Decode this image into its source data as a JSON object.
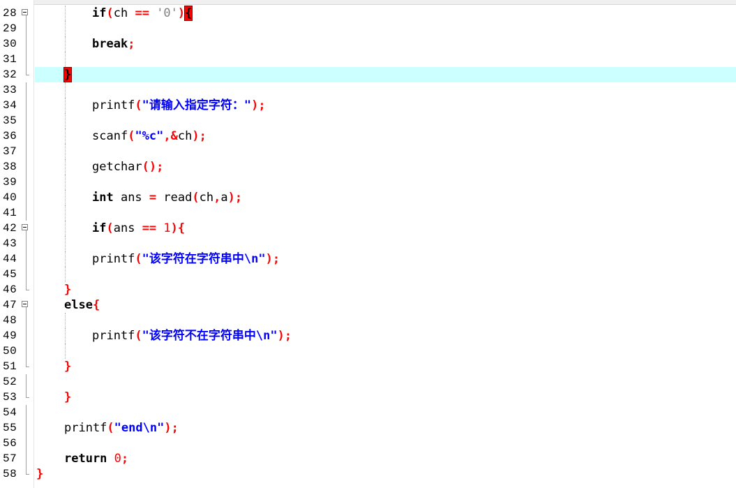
{
  "editor": {
    "current_line": 32,
    "lines": [
      {
        "n": "28",
        "fold": "start",
        "indent": 2,
        "code": [
          {
            "t": "kw",
            "v": "if"
          },
          {
            "t": "op",
            "v": "("
          },
          {
            "t": "id",
            "v": "ch "
          },
          {
            "t": "op",
            "v": "=="
          },
          {
            "t": "id",
            "v": " "
          },
          {
            "t": "char",
            "v": "'0'"
          },
          {
            "t": "op",
            "v": ")"
          },
          {
            "t": "bracehl",
            "v": "{"
          }
        ]
      },
      {
        "n": "29",
        "fold": "line",
        "indent": 2,
        "code": []
      },
      {
        "n": "30",
        "fold": "line",
        "indent": 2,
        "code": [
          {
            "t": "kw",
            "v": "break"
          },
          {
            "t": "op",
            "v": ";"
          }
        ]
      },
      {
        "n": "31",
        "fold": "line",
        "indent": 2,
        "code": []
      },
      {
        "n": "32",
        "fold": "end",
        "indent": 1,
        "current": true,
        "code": [
          {
            "t": "bracehl",
            "v": "}"
          }
        ]
      },
      {
        "n": "33",
        "fold": "line",
        "indent": 2,
        "code": []
      },
      {
        "n": "34",
        "fold": "line",
        "indent": 2,
        "code": [
          {
            "t": "id",
            "v": "printf"
          },
          {
            "t": "op",
            "v": "("
          },
          {
            "t": "str",
            "v": "\"请输入指定字符：\""
          },
          {
            "t": "op",
            "v": ");"
          }
        ]
      },
      {
        "n": "35",
        "fold": "line",
        "indent": 2,
        "code": []
      },
      {
        "n": "36",
        "fold": "line",
        "indent": 2,
        "code": [
          {
            "t": "id",
            "v": "scanf"
          },
          {
            "t": "op",
            "v": "("
          },
          {
            "t": "str",
            "v": "\"%c\""
          },
          {
            "t": "op",
            "v": ",&"
          },
          {
            "t": "id",
            "v": "ch"
          },
          {
            "t": "op",
            "v": ");"
          }
        ]
      },
      {
        "n": "37",
        "fold": "line",
        "indent": 2,
        "code": []
      },
      {
        "n": "38",
        "fold": "line",
        "indent": 2,
        "code": [
          {
            "t": "id",
            "v": "getchar"
          },
          {
            "t": "op",
            "v": "();"
          }
        ]
      },
      {
        "n": "39",
        "fold": "line",
        "indent": 2,
        "code": []
      },
      {
        "n": "40",
        "fold": "line",
        "indent": 2,
        "code": [
          {
            "t": "kw",
            "v": "int"
          },
          {
            "t": "id",
            "v": " ans "
          },
          {
            "t": "op",
            "v": "="
          },
          {
            "t": "id",
            "v": " read"
          },
          {
            "t": "op",
            "v": "("
          },
          {
            "t": "id",
            "v": "ch"
          },
          {
            "t": "op",
            "v": ","
          },
          {
            "t": "id",
            "v": "a"
          },
          {
            "t": "op",
            "v": ");"
          }
        ]
      },
      {
        "n": "41",
        "fold": "line",
        "indent": 2,
        "code": []
      },
      {
        "n": "42",
        "fold": "start",
        "indent": 2,
        "code": [
          {
            "t": "kw",
            "v": "if"
          },
          {
            "t": "op",
            "v": "("
          },
          {
            "t": "id",
            "v": "ans "
          },
          {
            "t": "op",
            "v": "=="
          },
          {
            "t": "id",
            "v": " "
          },
          {
            "t": "num",
            "v": "1"
          },
          {
            "t": "op",
            "v": "){"
          }
        ]
      },
      {
        "n": "43",
        "fold": "line",
        "indent": 2,
        "code": []
      },
      {
        "n": "44",
        "fold": "line",
        "indent": 2,
        "code": [
          {
            "t": "id",
            "v": "printf"
          },
          {
            "t": "op",
            "v": "("
          },
          {
            "t": "str",
            "v": "\"该字符在字符串中\\n\""
          },
          {
            "t": "op",
            "v": ");"
          }
        ]
      },
      {
        "n": "45",
        "fold": "line",
        "indent": 2,
        "code": []
      },
      {
        "n": "46",
        "fold": "end",
        "indent": 1,
        "code": [
          {
            "t": "op",
            "v": "}"
          }
        ]
      },
      {
        "n": "47",
        "fold": "start",
        "indent": 1,
        "code": [
          {
            "t": "kw",
            "v": "else"
          },
          {
            "t": "op",
            "v": "{"
          }
        ]
      },
      {
        "n": "48",
        "fold": "line",
        "indent": 2,
        "code": []
      },
      {
        "n": "49",
        "fold": "line",
        "indent": 2,
        "code": [
          {
            "t": "id",
            "v": "printf"
          },
          {
            "t": "op",
            "v": "("
          },
          {
            "t": "str",
            "v": "\"该字符不在字符串中\\n\""
          },
          {
            "t": "op",
            "v": ");"
          }
        ]
      },
      {
        "n": "50",
        "fold": "line",
        "indent": 2,
        "code": []
      },
      {
        "n": "51",
        "fold": "end",
        "indent": 1,
        "code": [
          {
            "t": "op",
            "v": "}"
          }
        ]
      },
      {
        "n": "52",
        "fold": "line",
        "indent": 1,
        "code": []
      },
      {
        "n": "53",
        "fold": "end",
        "indent": 1,
        "code": [
          {
            "t": "op",
            "v": "}"
          }
        ]
      },
      {
        "n": "54",
        "fold": "line",
        "indent": 1,
        "code": []
      },
      {
        "n": "55",
        "fold": "line",
        "indent": 1,
        "code": [
          {
            "t": "id",
            "v": "printf"
          },
          {
            "t": "op",
            "v": "("
          },
          {
            "t": "str",
            "v": "\"end\\n\""
          },
          {
            "t": "op",
            "v": ");"
          }
        ]
      },
      {
        "n": "56",
        "fold": "line",
        "indent": 1,
        "code": []
      },
      {
        "n": "57",
        "fold": "line",
        "indent": 1,
        "code": [
          {
            "t": "kw",
            "v": "return"
          },
          {
            "t": "id",
            "v": " "
          },
          {
            "t": "num",
            "v": "0"
          },
          {
            "t": "op",
            "v": ";"
          }
        ]
      },
      {
        "n": "58",
        "fold": "end",
        "indent": 0,
        "code": [
          {
            "t": "op",
            "v": "}"
          }
        ]
      }
    ]
  }
}
